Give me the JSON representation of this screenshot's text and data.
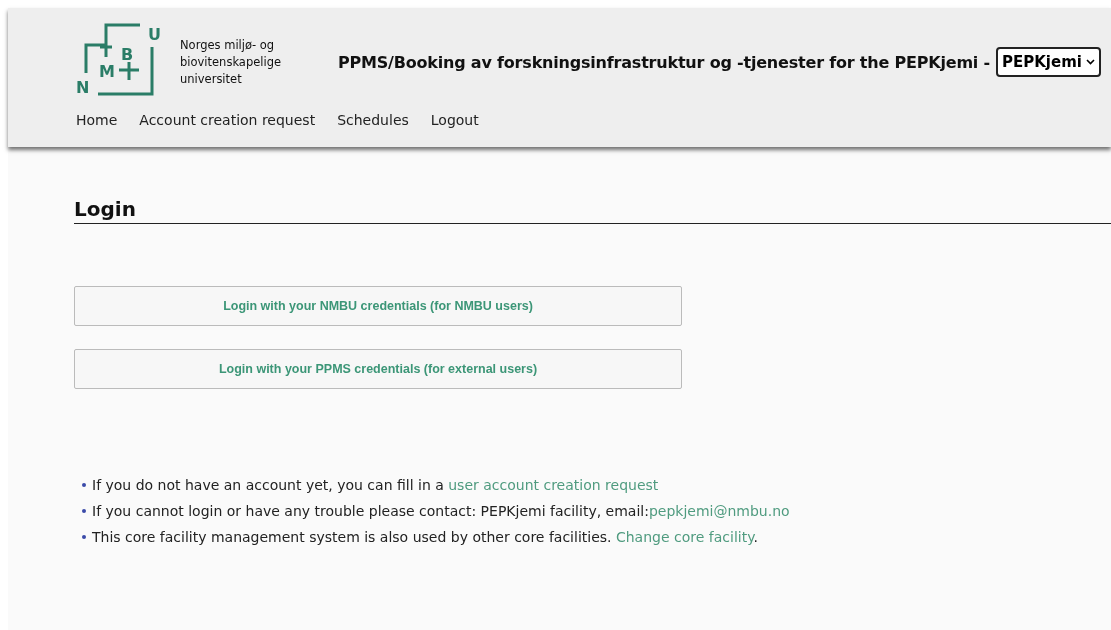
{
  "header": {
    "logo": {
      "letters": [
        "N",
        "M",
        "B",
        "U"
      ],
      "name_lines": [
        "Norges miljø- og",
        "biovitenskapelige",
        "universitet"
      ]
    },
    "title": "PPMS/Booking av forskningsinfrastruktur og -tjenester for the PEPKjemi -",
    "facility_select": {
      "value": "PEPKjemi"
    }
  },
  "nav": [
    {
      "label": "Home"
    },
    {
      "label": "Account creation request"
    },
    {
      "label": "Schedules"
    },
    {
      "label": "Logout"
    }
  ],
  "heading": "Login",
  "buttons": [
    {
      "label": "Login with your NMBU credentials (for NMBU users)"
    },
    {
      "label": "Login with your PPMS credentials (for external users)"
    }
  ],
  "info": [
    {
      "parts": [
        {
          "kind": "text",
          "text": "If you do not have an account yet, you can fill in a "
        },
        {
          "kind": "link",
          "text": "user account creation request"
        }
      ]
    },
    {
      "parts": [
        {
          "kind": "text",
          "text": "If you cannot login or have any trouble please contact: PEPKjemi facility, email:"
        },
        {
          "kind": "link",
          "text": "pepkjemi@nmbu.no"
        }
      ]
    },
    {
      "parts": [
        {
          "kind": "text",
          "text": "This core facility management system is also used by other core facilities. "
        },
        {
          "kind": "link",
          "text": "Change core facility"
        },
        {
          "kind": "text",
          "text": "."
        }
      ]
    }
  ]
}
